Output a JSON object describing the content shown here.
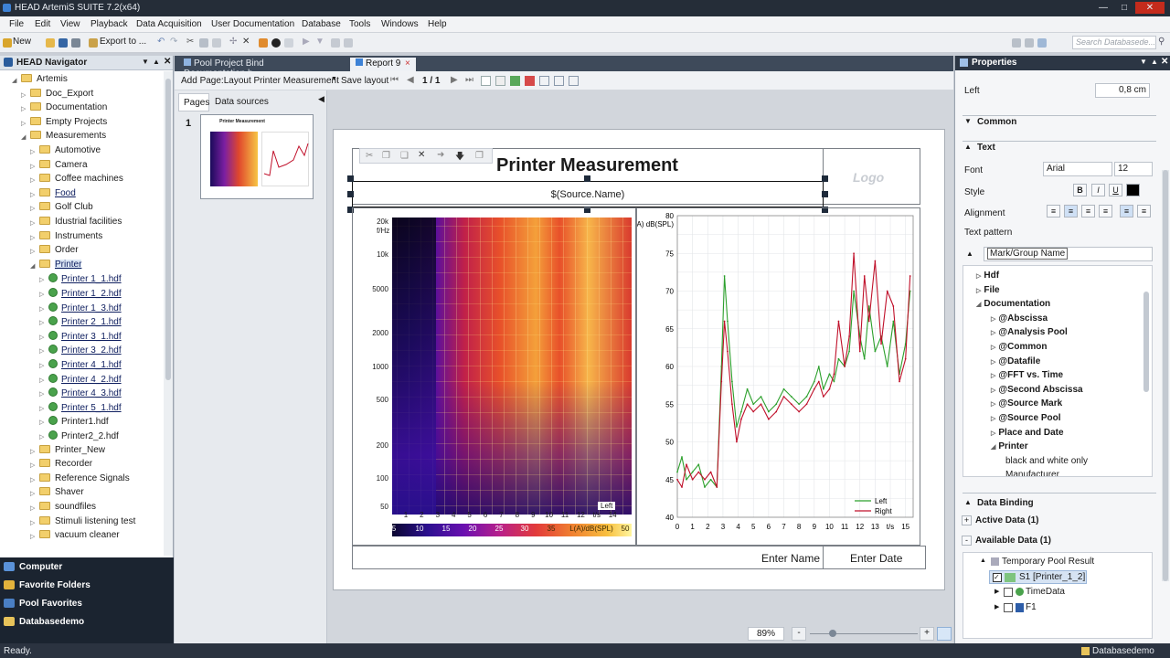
{
  "app": {
    "title": "HEAD ArtemiS SUITE 7.2(x64)"
  },
  "menu": [
    "File",
    "Edit",
    "View",
    "Playback",
    "Data Acquisition",
    "User Documentation",
    "Database",
    "Tools",
    "Windows",
    "Help"
  ],
  "toolbar": {
    "new": "New",
    "export": "Export to ...",
    "search_placeholder": "Search Databasede..."
  },
  "navigator": {
    "title": "HEAD Navigator",
    "items": [
      {
        "label": "Artemis",
        "type": "folder",
        "level": 0,
        "open": true
      },
      {
        "label": "Doc_Export",
        "type": "folder",
        "level": 1
      },
      {
        "label": "Documentation",
        "type": "folder",
        "level": 1
      },
      {
        "label": "Empty Projects",
        "type": "folder",
        "level": 1
      },
      {
        "label": "Measurements",
        "type": "folder",
        "level": 1,
        "open": true
      },
      {
        "label": "Automotive",
        "type": "folder",
        "level": 2
      },
      {
        "label": "Camera",
        "type": "folder",
        "level": 2
      },
      {
        "label": "Coffee machines",
        "type": "folder",
        "level": 2
      },
      {
        "label": "Food",
        "type": "folder",
        "level": 2,
        "link": true
      },
      {
        "label": "Golf Club",
        "type": "folder",
        "level": 2
      },
      {
        "label": "Idustrial facilities",
        "type": "folder",
        "level": 2
      },
      {
        "label": "Instruments",
        "type": "folder",
        "level": 2
      },
      {
        "label": "Order",
        "type": "folder",
        "level": 2
      },
      {
        "label": "Printer",
        "type": "folder",
        "level": 2,
        "open": true,
        "link": true
      },
      {
        "label": "Printer 1_1.hdf",
        "type": "file",
        "level": 3,
        "link": true
      },
      {
        "label": "Printer 1_2.hdf",
        "type": "file",
        "level": 3,
        "link": true
      },
      {
        "label": "Printer 1_3.hdf",
        "type": "file",
        "level": 3,
        "link": true
      },
      {
        "label": "Printer 2_1.hdf",
        "type": "file",
        "level": 3,
        "link": true
      },
      {
        "label": "Printer 3_1.hdf",
        "type": "file",
        "level": 3,
        "link": true
      },
      {
        "label": "Printer 3_2.hdf",
        "type": "file",
        "level": 3,
        "link": true
      },
      {
        "label": "Printer 4_1.hdf",
        "type": "file",
        "level": 3,
        "link": true
      },
      {
        "label": "Printer 4_2.hdf",
        "type": "file",
        "level": 3,
        "link": true
      },
      {
        "label": "Printer 4_3.hdf",
        "type": "file",
        "level": 3,
        "link": true
      },
      {
        "label": "Printer 5_1.hdf",
        "type": "file",
        "level": 3,
        "link": true
      },
      {
        "label": "Printer1.hdf",
        "type": "file",
        "level": 3
      },
      {
        "label": "Printer2_2.hdf",
        "type": "file",
        "level": 3
      },
      {
        "label": "Printer_New",
        "type": "folder",
        "level": 2
      },
      {
        "label": "Recorder",
        "type": "folder",
        "level": 2
      },
      {
        "label": "Reference Signals",
        "type": "folder",
        "level": 2
      },
      {
        "label": "Shaver",
        "type": "folder",
        "level": 2
      },
      {
        "label": "soundfiles",
        "type": "folder",
        "level": 2
      },
      {
        "label": "Stimuli listening test",
        "type": "folder",
        "level": 2
      },
      {
        "label": "vacuum cleaner",
        "type": "folder",
        "level": 2
      }
    ],
    "bottom": [
      "Computer",
      "Favorite Folders",
      "Pool Favorites",
      "Databasedemo"
    ]
  },
  "tabs": [
    "Pool Project Bind Documentation.h...",
    "Report 9"
  ],
  "report_toolbar": {
    "add_page": "Add Page:Layout Printer Measurement",
    "save_layout": "Save layout",
    "page": "1 / 1"
  },
  "pages_panel": {
    "tabs": [
      "Pages",
      "Data sources"
    ],
    "page_number": "1",
    "thumb_title": "Printer Measurement"
  },
  "report": {
    "title": "Printer Measurement",
    "source": "$(Source.Name)",
    "logo": "Logo",
    "enter_name": "Enter Name",
    "enter_date": "Enter Date"
  },
  "spectrogram": {
    "yunit": "f/Hz",
    "yticks": [
      "20k",
      "10k",
      "5000",
      "2000",
      "1000",
      "500",
      "200",
      "100",
      "50"
    ],
    "xticks": [
      "1",
      "2",
      "3",
      "4",
      "5",
      "6",
      "7",
      "8",
      "9",
      "10",
      "11",
      "12",
      "t/s",
      "14"
    ],
    "channel": "Left",
    "colorbar": [
      "5",
      "10",
      "15",
      "20",
      "25",
      "30",
      "35",
      "L(A)/dB(SPL)",
      "50"
    ]
  },
  "chart_data": {
    "type": "line",
    "ylabel": "L(A) dB(SPL)",
    "xlabel": "t/s",
    "xlim": [
      0,
      15.5
    ],
    "ylim": [
      40,
      80
    ],
    "xticks": [
      "0",
      "1",
      "2",
      "3",
      "4",
      "5",
      "6",
      "7",
      "8",
      "9",
      "10",
      "11",
      "12",
      "13",
      "t/s",
      "15"
    ],
    "yticks": [
      "80",
      "75",
      "70",
      "65",
      "60",
      "55",
      "50",
      "45",
      "40"
    ],
    "series": [
      {
        "name": "Left",
        "color": "#2ca02c",
        "x": [
          0,
          0.3,
          0.6,
          1,
          1.4,
          1.8,
          2.2,
          2.6,
          2.9,
          3.1,
          3.3,
          3.6,
          3.9,
          4.2,
          4.6,
          5,
          5.5,
          6,
          6.5,
          7,
          7.5,
          8,
          8.5,
          9,
          9.3,
          9.6,
          10,
          10.3,
          10.6,
          11,
          11.3,
          11.6,
          12,
          12.3,
          12.6,
          13,
          13.4,
          13.8,
          14.2,
          14.6,
          15,
          15.3
        ],
        "y": [
          46,
          48,
          45,
          46,
          47,
          44,
          45,
          44,
          60,
          72,
          66,
          58,
          52,
          54,
          57,
          55,
          56,
          54,
          55,
          57,
          56,
          55,
          56,
          58,
          60,
          57,
          59,
          58,
          61,
          60,
          62,
          70,
          64,
          61,
          68,
          62,
          64,
          60,
          66,
          59,
          63,
          70
        ]
      },
      {
        "name": "Right",
        "color": "#c0102a",
        "x": [
          0,
          0.3,
          0.6,
          1,
          1.4,
          1.8,
          2.2,
          2.6,
          2.9,
          3.1,
          3.3,
          3.6,
          3.9,
          4.2,
          4.6,
          5,
          5.5,
          6,
          6.5,
          7,
          7.5,
          8,
          8.5,
          9,
          9.3,
          9.6,
          10,
          10.3,
          10.6,
          11,
          11.3,
          11.6,
          12,
          12.3,
          12.6,
          13,
          13.4,
          13.8,
          14.2,
          14.6,
          15,
          15.3
        ],
        "y": [
          45,
          44,
          47,
          45,
          46,
          45,
          46,
          44,
          58,
          66,
          62,
          55,
          50,
          53,
          55,
          54,
          55,
          53,
          54,
          56,
          55,
          54,
          55,
          57,
          58,
          56,
          57,
          59,
          66,
          60,
          64,
          75,
          62,
          72,
          66,
          74,
          63,
          70,
          68,
          58,
          61,
          72
        ]
      }
    ]
  },
  "properties": {
    "title": "Properties",
    "left_label": "Left",
    "left_value": "0,8 cm",
    "sections": [
      "Common",
      "Text",
      "Data Binding"
    ],
    "font_label": "Font",
    "font_value": "Arial",
    "size_value": "12",
    "style_label": "Style",
    "style_buttons": [
      "B",
      "I",
      "U"
    ],
    "alignment_label": "Alignment",
    "text_pattern_label": "Text pattern",
    "text_pattern_value": "Mark/Group Name",
    "pattern_tree": [
      {
        "label": "Hdf",
        "level": 0,
        "bold": true
      },
      {
        "label": "File",
        "level": 0,
        "bold": true
      },
      {
        "label": "Documentation",
        "level": 0,
        "bold": true,
        "open": true
      },
      {
        "label": "@Abscissa",
        "level": 1,
        "bold": true
      },
      {
        "label": "@Analysis Pool",
        "level": 1,
        "bold": true
      },
      {
        "label": "@Common",
        "level": 1,
        "bold": true
      },
      {
        "label": "@Datafile",
        "level": 1,
        "bold": true
      },
      {
        "label": "@FFT vs. Time",
        "level": 1,
        "bold": true
      },
      {
        "label": "@Second Abscissa",
        "level": 1,
        "bold": true
      },
      {
        "label": "@Source Mark",
        "level": 1,
        "bold": true
      },
      {
        "label": "@Source Pool",
        "level": 1,
        "bold": true
      },
      {
        "label": "Place and Date",
        "level": 1,
        "bold": true
      },
      {
        "label": "Printer",
        "level": 1,
        "bold": true,
        "open": true
      },
      {
        "label": "black and white only",
        "level": 2,
        "bold": false
      },
      {
        "label": "Manufacturer",
        "level": 2,
        "bold": false
      }
    ],
    "active_data": "Active Data (1)",
    "available_data": "Available Data (1)",
    "data_tree": [
      "Temporary Pool Result",
      "S1  [Printer_1_2]",
      "TimeData",
      "F1"
    ]
  },
  "zoom": "89%",
  "status": {
    "left": "Ready.",
    "right": "Databasedemo"
  },
  "colors": {
    "accent": "#3d82d6",
    "panel_header": "#2c3644",
    "folder": "#f2cf6b",
    "hdf": "#4aa24c"
  }
}
